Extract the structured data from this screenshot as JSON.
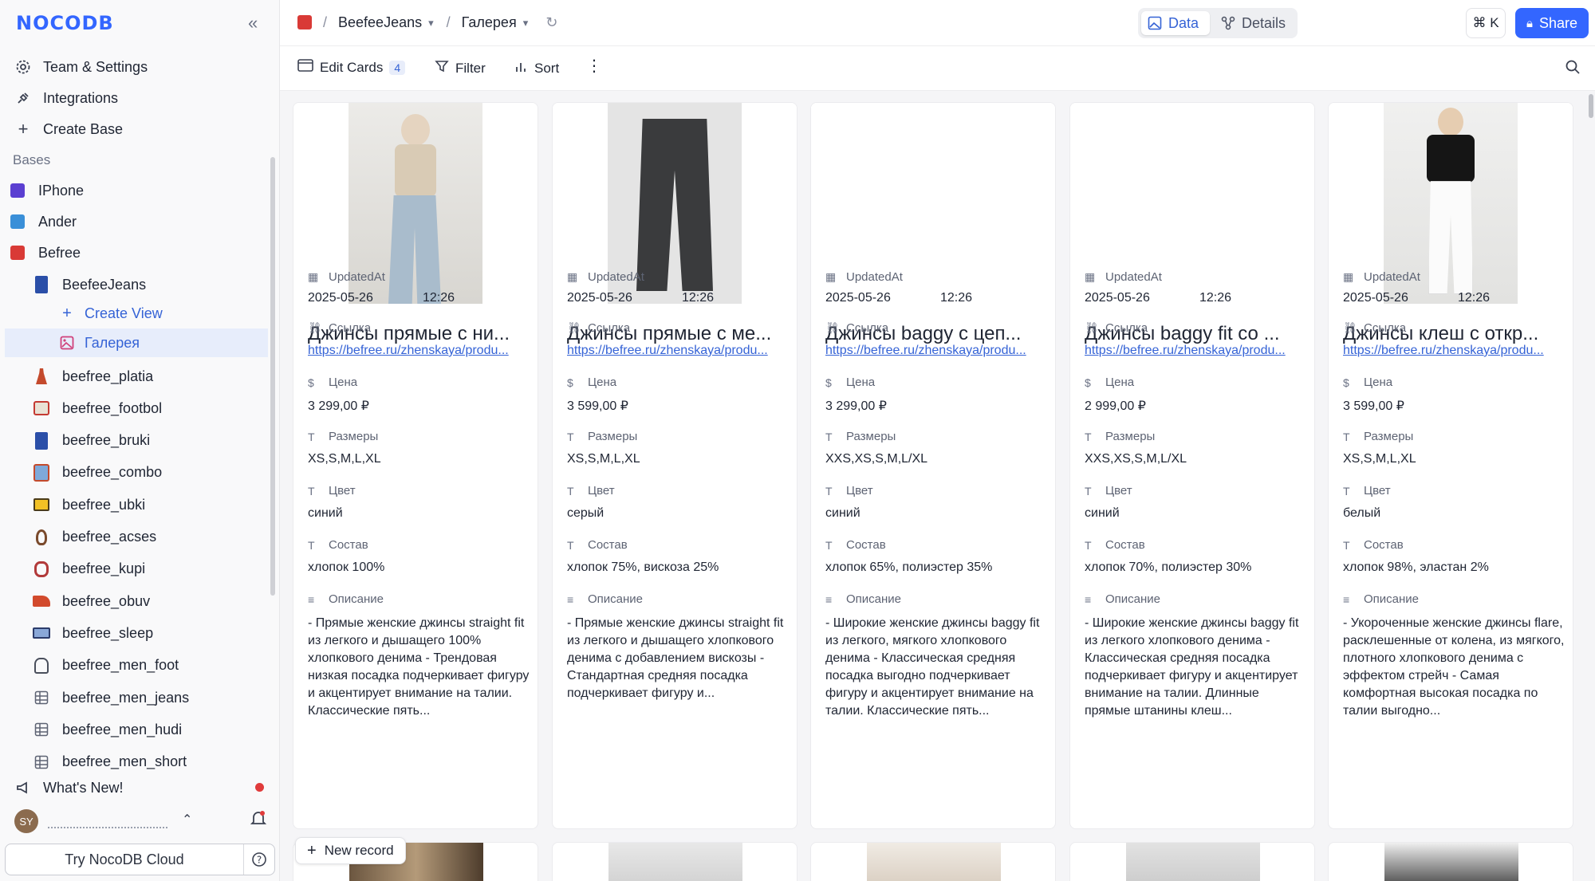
{
  "app": {
    "logo": "NOCODB"
  },
  "sidebar": {
    "team_settings": "Team & Settings",
    "integrations": "Integrations",
    "create_base": "Create Base",
    "bases_label": "Bases",
    "bases": [
      {
        "label": "IPhone",
        "color": "#5b3fd1"
      },
      {
        "label": "Ander",
        "color": "#3a8fd8"
      },
      {
        "label": "Befree",
        "color": "#d93a36"
      }
    ],
    "befree_table": "BeefeeJeans",
    "create_view": "Create View",
    "gallery_view": "Галерея",
    "tables": [
      {
        "label": "beefree_platia",
        "icon": "dress-icon"
      },
      {
        "label": "beefree_footbol",
        "icon": "tshirt-icon"
      },
      {
        "label": "beefree_bruki",
        "icon": "jeans-icon"
      },
      {
        "label": "beefree_combo",
        "icon": "jacket-icon"
      },
      {
        "label": "beefree_ubki",
        "icon": "shorts-icon"
      },
      {
        "label": "beefree_acses",
        "icon": "ear-icon"
      },
      {
        "label": "beefree_kupi",
        "icon": "bikini-icon"
      },
      {
        "label": "beefree_obuv",
        "icon": "shoe-icon"
      },
      {
        "label": "beefree_sleep",
        "icon": "bed-icon"
      },
      {
        "label": "beefree_men_foot",
        "icon": "shirt-icon"
      },
      {
        "label": "beefree_men_jeans",
        "icon": "grid-icon"
      },
      {
        "label": "beefree_men_hudi",
        "icon": "grid-icon"
      },
      {
        "label": "beefree_men_short",
        "icon": "grid-icon"
      }
    ],
    "whats_new": "What's New!",
    "avatar_initials": "SY",
    "try_cloud": "Try NocoDB Cloud"
  },
  "topbar": {
    "crumb_base": "BeefeeJeans",
    "crumb_view": "Галерея",
    "tab_data": "Data",
    "tab_details": "Details",
    "shortcut": "⌘ K",
    "share": "Share"
  },
  "toolbar": {
    "edit_cards": "Edit Cards",
    "edit_cards_count": "4",
    "filter": "Filter",
    "sort": "Sort"
  },
  "fields": {
    "updated": "UpdatedAt",
    "link": "Ссылка",
    "price": "Цена",
    "sizes": "Размеры",
    "color": "Цвет",
    "composition": "Состав",
    "description": "Описание"
  },
  "cards": [
    {
      "title": "Джинсы прямые с ни...",
      "date": "2025-05-26",
      "time": "12:26",
      "link": "https://befree.ru/zhenskaya/produ...",
      "price": "3 299,00 ₽",
      "sizes": "XS,S,M,L,XL",
      "color": "синий",
      "composition": "хлопок 100%",
      "description": "- Прямые женские джинсы straight fit из легкого и дышащего 100% хлопкового денима - Трендовая низкая посадка подчеркивает фигуру и акцентирует внимание на талии. Классические пять..."
    },
    {
      "title": "Джинсы прямые с ме...",
      "date": "2025-05-26",
      "time": "12:26",
      "link": "https://befree.ru/zhenskaya/produ...",
      "price": "3 599,00 ₽",
      "sizes": "XS,S,M,L,XL",
      "color": "серый",
      "composition": "хлопок 75%, вискоза 25%",
      "description": "- Прямые женские джинсы straight fit из легкого и дышащего хлопкового денима с добавлением вискозы - Стандартная средняя посадка подчеркивает фигуру и..."
    },
    {
      "title": "Джинсы baggy с цеп...",
      "date": "2025-05-26",
      "time": "12:26",
      "link": "https://befree.ru/zhenskaya/produ...",
      "price": "3 299,00 ₽",
      "sizes": "XXS,XS,S,M,L/XL",
      "color": "синий",
      "composition": "хлопок 65%, полиэстер 35%",
      "description": "- Широкие женские джинсы baggy fit из легкого, мягкого хлопкового денима - Классическая средняя посадка выгодно подчеркивает фигуру и акцентирует внимание на талии. Классические пять..."
    },
    {
      "title": "Джинсы baggy fit со ...",
      "date": "2025-05-26",
      "time": "12:26",
      "link": "https://befree.ru/zhenskaya/produ...",
      "price": "2 999,00 ₽",
      "sizes": "XXS,XS,S,M,L/XL",
      "color": "синий",
      "composition": "хлопок 70%, полиэстер 30%",
      "description": "- Широкие женские джинсы baggy fit из легкого хлопкового денима - Классическая средняя посадка подчеркивает фигуру и акцентирует внимание на талии. Длинные прямые штанины клеш..."
    },
    {
      "title": "Джинсы клеш с откр...",
      "date": "2025-05-26",
      "time": "12:26",
      "link": "https://befree.ru/zhenskaya/produ...",
      "price": "3 599,00 ₽",
      "sizes": "XS,S,M,L,XL",
      "color": "белый",
      "composition": "хлопок 98%, эластан 2%",
      "description": "- Укороченные женские джинсы flare, расклешенные от колена, из мягкого, плотного хлопкового денима с эффектом стрейч - Самая комфортная высокая посадка по талии выгодно..."
    }
  ],
  "new_record": "New record"
}
